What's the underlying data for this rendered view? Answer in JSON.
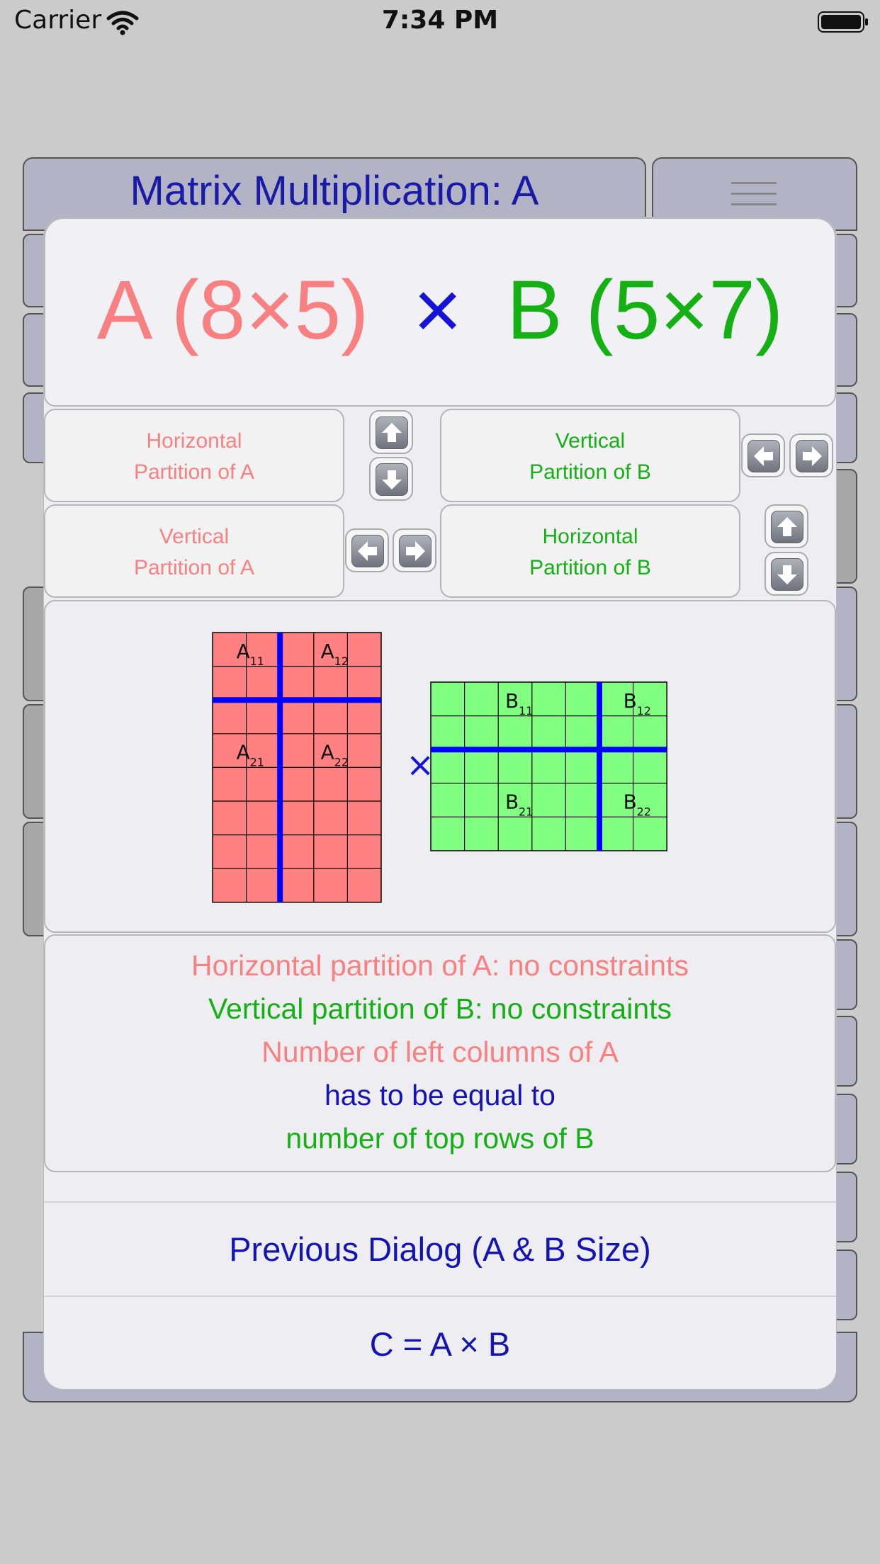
{
  "status_bar": {
    "carrier": "Carrier",
    "time": "7:34 PM"
  },
  "background": {
    "title": "Matrix Multiplication: A"
  },
  "dialog": {
    "title": {
      "a": "A (8×5)",
      "times": "×",
      "b": "B (5×7)"
    },
    "buttons": {
      "horizontal_a": {
        "line1": "Horizontal",
        "line2": "Partition of A"
      },
      "vertical_b": {
        "line1": "Vertical",
        "line2": "Partition of B"
      },
      "vertical_a": {
        "line1": "Vertical",
        "line2": "Partition of A"
      },
      "horizontal_b": {
        "line1": "Horizontal",
        "line2": "Partition of B"
      }
    },
    "arrow_icons": [
      "arrow-up-icon",
      "arrow-down-icon",
      "arrow-left-icon",
      "arrow-right-icon"
    ],
    "diagram": {
      "matrix_a": {
        "rows": 8,
        "cols": 5,
        "split_row": 2,
        "split_col": 2,
        "color": "#ff8080",
        "labels": [
          {
            "main": "A",
            "sub": "11"
          },
          {
            "main": "A",
            "sub": "12"
          },
          {
            "main": "A",
            "sub": "21"
          },
          {
            "main": "A",
            "sub": "22"
          }
        ]
      },
      "times": "×",
      "matrix_b": {
        "rows": 5,
        "cols": 7,
        "split_row": 2,
        "split_col": 5,
        "color": "#80ff80",
        "labels": [
          {
            "main": "B",
            "sub": "11"
          },
          {
            "main": "B",
            "sub": "12"
          },
          {
            "main": "B",
            "sub": "21"
          },
          {
            "main": "B",
            "sub": "22"
          }
        ]
      },
      "partition_color": "#0000ff"
    },
    "info": [
      "Horizontal partition of A: no constraints",
      "Vertical partition of B: no constraints",
      "Number of left columns of A",
      "has to be equal to",
      "number of top rows of B"
    ],
    "actions": {
      "previous": "Previous Dialog (A & B Size)",
      "compute": "C = A × B"
    }
  },
  "colors": {
    "a": "#f98080",
    "b": "#14b014",
    "accent": "#1414b4"
  }
}
